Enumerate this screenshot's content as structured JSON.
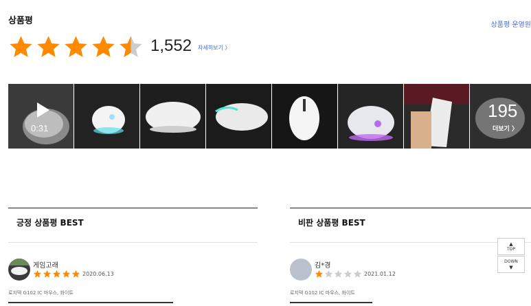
{
  "header": {
    "title": "상품평",
    "policy_link": "상품평 운영원"
  },
  "summary": {
    "rating": 4.5,
    "rating_max": 5,
    "count": "1,552",
    "detail_link": "자세히보기 〉"
  },
  "photos": {
    "video_duration": "0:31",
    "more_count": "195",
    "more_label": "더보기 〉"
  },
  "best_positive": {
    "title": "긍정 상품평 BEST",
    "reviewer": "게임고래",
    "rating": 5,
    "date": "2020.06.13",
    "option": "로지텍 G102 IC 마우스, 화이트"
  },
  "best_negative": {
    "title": "비판 상품평 BEST",
    "reviewer": "김*경",
    "rating": 1,
    "date": "2021.01.12",
    "option": "로지텍 G102 IC 마우스, 화이트"
  },
  "floating": {
    "top_label": "TOP",
    "down_label": "DOWN"
  },
  "colors": {
    "star": "#ff8a00",
    "star_empty": "#cccccc",
    "link": "#346aff"
  }
}
